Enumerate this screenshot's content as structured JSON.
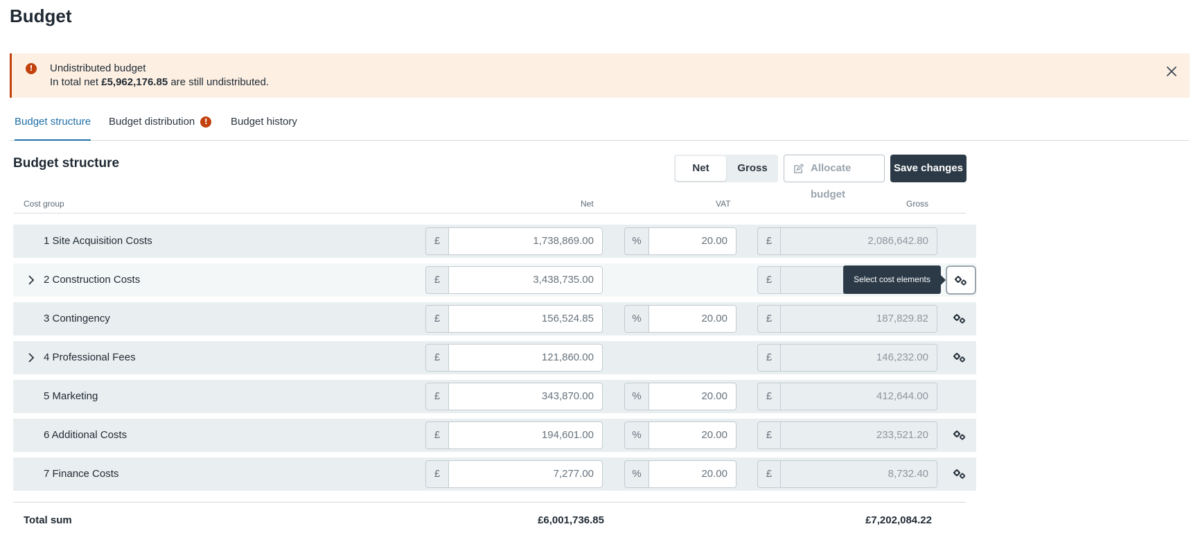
{
  "page": {
    "title": "Budget"
  },
  "alert": {
    "title": "Undistributed budget",
    "text_prefix": "In total net",
    "amount": "£5,962,176.85",
    "text_suffix": "are still undistributed."
  },
  "tabs": [
    {
      "label": "Budget structure",
      "active": true
    },
    {
      "label": "Budget distribution",
      "badge": "!"
    },
    {
      "label": "Budget history"
    }
  ],
  "section": {
    "title": "Budget structure"
  },
  "toolbar": {
    "net_label": "Net",
    "gross_label": "Gross",
    "allocate_label": "Allocate budget",
    "save_label": "Save changes"
  },
  "table": {
    "headers": {
      "cost_group": "Cost group",
      "net": "Net",
      "vat": "VAT",
      "gross": "Gross"
    },
    "currency": "£",
    "percent": "%",
    "rows": [
      {
        "label": "1 Site Acquisition Costs",
        "net": "1,738,869.00",
        "vat": "20.00",
        "gross": "2,086,642.80"
      },
      {
        "label": "2 Construction Costs",
        "net": "3,438,735.00",
        "vat": "",
        "gross": ""
      },
      {
        "label": "3 Contingency",
        "net": "156,524.85",
        "vat": "20.00",
        "gross": "187,829.82"
      },
      {
        "label": "4 Professional Fees",
        "net": "121,860.00",
        "vat": "",
        "gross": "146,232.00"
      },
      {
        "label": "5 Marketing",
        "net": "343,870.00",
        "vat": "20.00",
        "gross": "412,644.00"
      },
      {
        "label": "6 Additional Costs",
        "net": "194,601.00",
        "vat": "20.00",
        "gross": "233,521.20"
      },
      {
        "label": "7 Finance Costs",
        "net": "7,277.00",
        "vat": "20.00",
        "gross": "8,732.40"
      }
    ],
    "tooltip": "Select cost elements",
    "total": {
      "label": "Total sum",
      "net": "£6,001,736.85",
      "gross": "£7,202,084.22"
    }
  },
  "colors": {
    "accent": "#1f6fa8",
    "warning": "#c2410c",
    "dark_button": "#2c3a47",
    "row_bg": "#e9eff0"
  },
  "icons": {
    "alert": "info-icon",
    "close": "close-icon",
    "expand": "chevron-right-icon",
    "cost_elements": "gears-icon",
    "allocate": "edit-icon"
  }
}
